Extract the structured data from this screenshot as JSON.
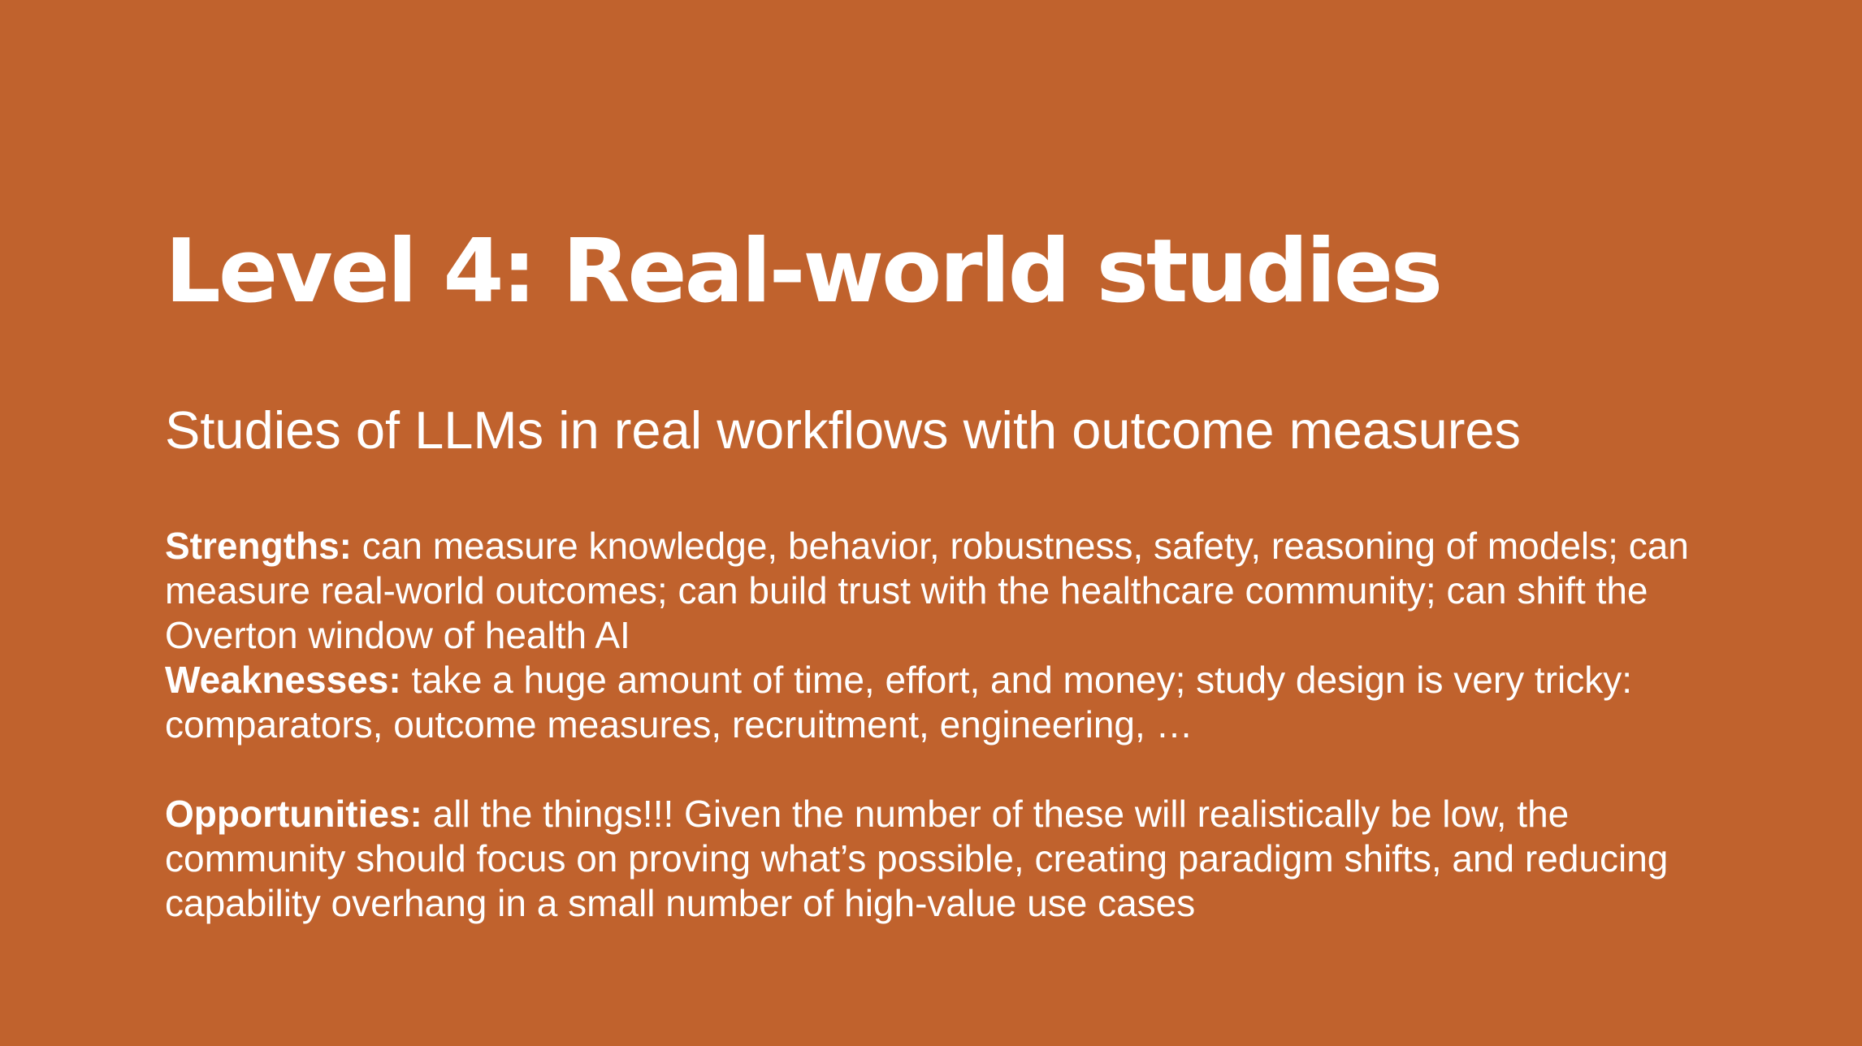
{
  "slide": {
    "background_color": "#C0622D",
    "text_color": "#FFFFFF",
    "title": "Level 4: Real-world studies",
    "subtitle": "Studies of LLMs in real workflows with outcome measures",
    "strengths": {
      "label": "Strengths:",
      "text": " can measure knowledge, behavior, robustness, safety, reasoning of models; can measure real-world outcomes; can build trust with the healthcare community; can shift the Overton window of health AI"
    },
    "weaknesses": {
      "label": "Weaknesses:",
      "text": " take a huge amount of time, effort, and money; study design is very tricky: comparators, outcome measures, recruitment, engineering, …"
    },
    "opportunities": {
      "label": "Opportunities:",
      "text": " all the things!!! Given the number of these will realistically be low, the community should focus on proving what’s possible, creating paradigm shifts, and reducing capability overhang in a small number of high-value use cases"
    }
  }
}
